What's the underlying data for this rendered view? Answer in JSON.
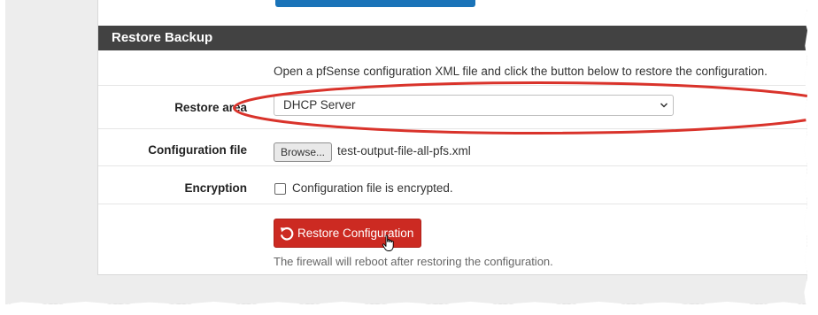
{
  "section": {
    "title": "Restore Backup",
    "intro": "Open a pfSense configuration XML file and click the button below to restore the configuration."
  },
  "restore_area": {
    "label": "Restore area",
    "selected": "DHCP Server"
  },
  "config_file": {
    "label": "Configuration file",
    "browse_label": "Browse...",
    "filename": "test-output-file-all-pfs.xml"
  },
  "encryption": {
    "label": "Encryption",
    "checkbox_label": "Configuration file is encrypted.",
    "checked": false
  },
  "restore_button": {
    "label": "Restore Configuration",
    "help": "The firewall will reboot after restoring the configuration."
  },
  "colors": {
    "heading_bg": "#424242",
    "button_red": "#cc2a22",
    "annotation_red": "#d9332b",
    "top_bar_blue": "#1a73b8"
  },
  "icons": {
    "select_arrow": "chevron-down-icon",
    "button_icon": "undo-icon",
    "pointer": "hand-cursor-icon"
  }
}
